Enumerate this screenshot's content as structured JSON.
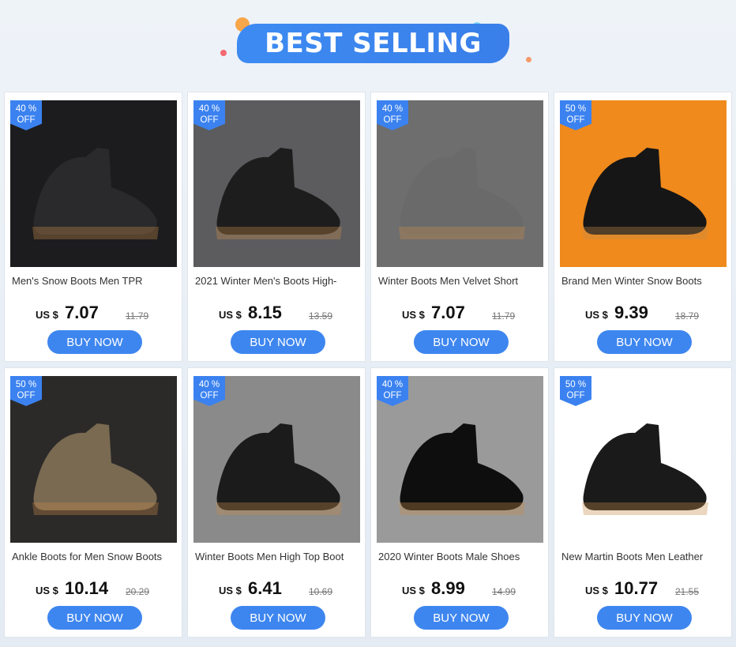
{
  "banner": {
    "title": "BEST SELLING"
  },
  "colors": {
    "accent": "#3e86ef",
    "tag": "#3b82f0",
    "card_bg": "#ffffff",
    "page_bg": "#eef3f8"
  },
  "products": [
    {
      "discount_pct": "40 %",
      "discount_off": "OFF",
      "name": "Men's Snow Boots Men TPR",
      "currency": "US $",
      "price": "7.07",
      "old_price": "11.79",
      "button": "BUY NOW",
      "photo_bg": "#1c1c1e",
      "shoe": "#2a2a2c"
    },
    {
      "discount_pct": "40 %",
      "discount_off": "OFF",
      "name": "2021 Winter Men's Boots High-",
      "currency": "US $",
      "price": "8.15",
      "old_price": "13.59",
      "button": "BUY NOW",
      "photo_bg": "#5c5c5e",
      "shoe": "#1d1d1d"
    },
    {
      "discount_pct": "40 %",
      "discount_off": "OFF",
      "name": "Winter Boots Men Velvet Short",
      "currency": "US $",
      "price": "7.07",
      "old_price": "11.79",
      "button": "BUY NOW",
      "photo_bg": "#6e6e6e",
      "shoe": "#6a6a6a"
    },
    {
      "discount_pct": "50 %",
      "discount_off": "OFF",
      "name": "Brand Men Winter Snow Boots",
      "currency": "US $",
      "price": "9.39",
      "old_price": "18.79",
      "button": "BUY NOW",
      "photo_bg": "#f08a1c",
      "shoe": "#161616"
    },
    {
      "discount_pct": "50 %",
      "discount_off": "OFF",
      "name": "Ankle Boots for Men Snow Boots",
      "currency": "US $",
      "price": "10.14",
      "old_price": "20.29",
      "button": "BUY NOW",
      "photo_bg": "#2c2a28",
      "shoe": "#7a6a52"
    },
    {
      "discount_pct": "40 %",
      "discount_off": "OFF",
      "name": "Winter Boots Men High Top Boot",
      "currency": "US $",
      "price": "6.41",
      "old_price": "10.69",
      "button": "BUY NOW",
      "photo_bg": "#8a8a8a",
      "shoe": "#1b1b1b"
    },
    {
      "discount_pct": "40 %",
      "discount_off": "OFF",
      "name": "2020 Winter Boots Male Shoes",
      "currency": "US $",
      "price": "8.99",
      "old_price": "14.99",
      "button": "BUY NOW",
      "photo_bg": "#9a9a9a",
      "shoe": "#0e0e0e"
    },
    {
      "discount_pct": "50 %",
      "discount_off": "OFF",
      "name": "New Martin Boots Men Leather",
      "currency": "US $",
      "price": "10.77",
      "old_price": "21.55",
      "button": "BUY NOW",
      "photo_bg": "#ffffff",
      "shoe": "#1a1a1a"
    }
  ]
}
